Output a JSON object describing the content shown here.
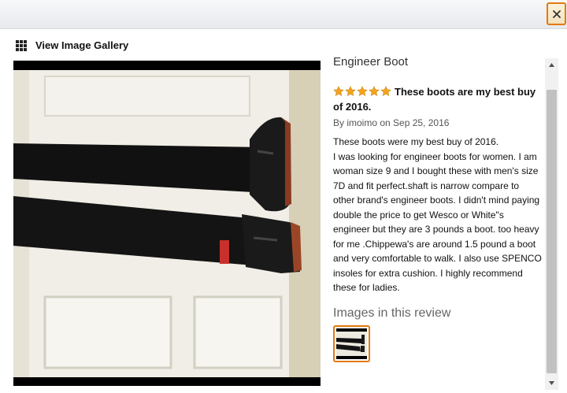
{
  "header": {
    "close_icon": "close-icon"
  },
  "gallery": {
    "label": "View Image Gallery",
    "icon": "grid-icon"
  },
  "review": {
    "product_title": "Engineer Boot",
    "rating": 5,
    "rating_max": 5,
    "headline": "These boots are my best buy of 2016.",
    "byline": "By imoimo on Sep 25, 2016",
    "body": "These boots were my best buy of 2016.\nI was looking for engineer boots for women. I am woman size 9 and I bought these with men's size 7D and fit perfect.shaft is narrow compare to other brand's engineer boots. I didn't mind paying double the price to get Wesco or White\"s engineer but they are 3 pounds a boot. too heavy for me .Chippewa's are around 1.5 pound a boot and very comfortable to walk. I also use SPENCO insoles for extra cushion. I highly recommend these for ladies.",
    "images_heading": "Images in this review"
  },
  "colors": {
    "accent": "#e47911",
    "star": "#f4a41c"
  }
}
